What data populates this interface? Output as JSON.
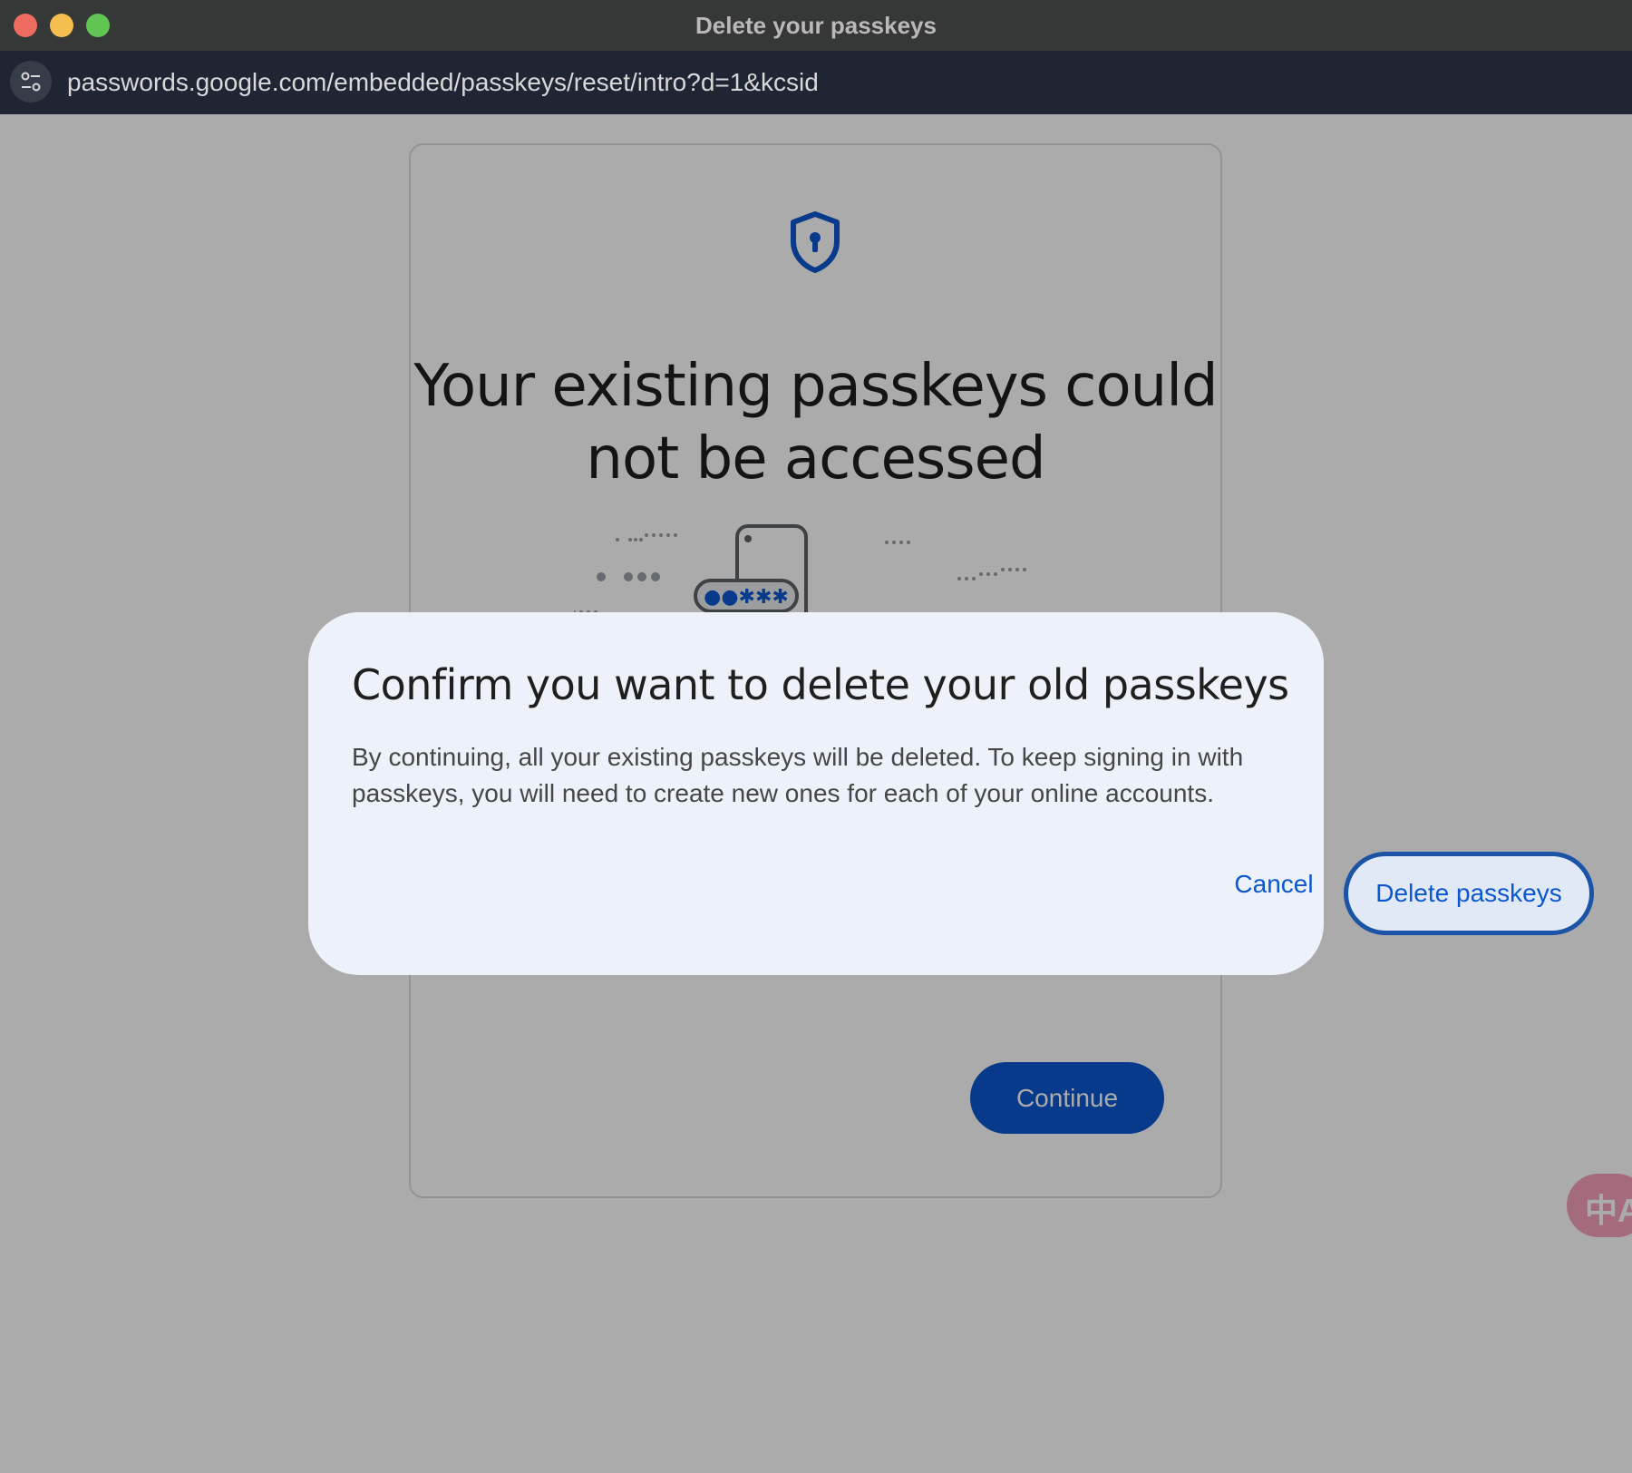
{
  "window": {
    "title": "Delete your passkeys"
  },
  "address_bar": {
    "url": "passwords.google.com/embedded/passkeys/reset/intro?d=1&kcsid"
  },
  "page": {
    "icon": "shield-keyhole-icon",
    "title": "Your existing passkeys could not be accessed",
    "illustration_password": "●●✱✱✱",
    "continue_label": "Continue"
  },
  "dialog": {
    "title": "Confirm you want to delete your old passkeys",
    "body": "By continuing, all your existing passkeys will be deleted. To keep signing in with passkeys, you will need to create new ones for each of your online accounts.",
    "cancel_label": "Cancel",
    "confirm_label": "Delete passkeys"
  },
  "translate_fab": {
    "icon": "translate-icon",
    "glyph": "中A"
  },
  "colors": {
    "accent": "#0b57d0",
    "dialog_background": "#edf2fa",
    "title_bar": "#363737",
    "address_bar": "#1f2533"
  }
}
